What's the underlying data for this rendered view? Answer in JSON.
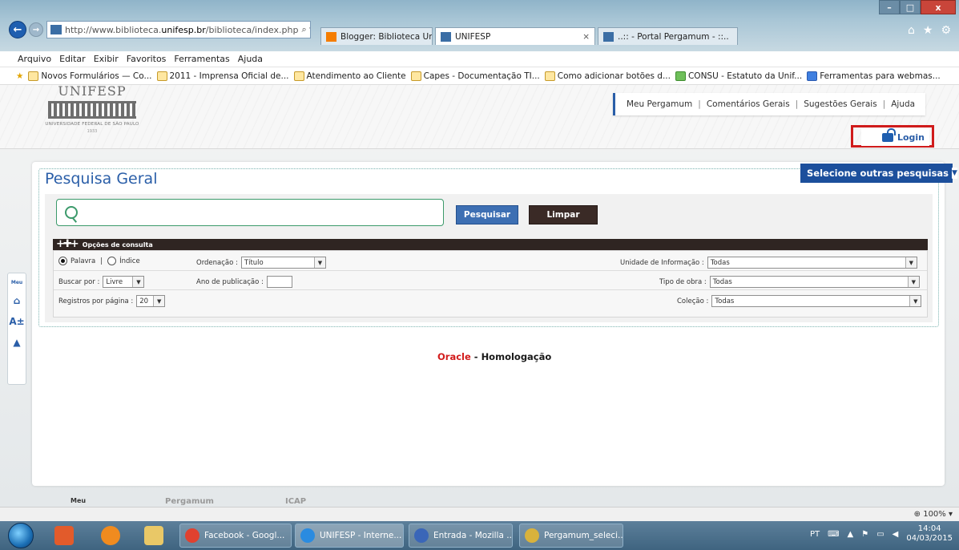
{
  "browser": {
    "url_prefix": "http://www.biblioteca.",
    "url_host": "unifesp.br",
    "url_suffix": "/biblioteca/index.php",
    "url_tools": "⌕ ▾ C",
    "tabs": [
      {
        "label": "Blogger: Biblioteca Unifesp Ca...",
        "icon_color": "#f57d00"
      },
      {
        "label": "UNIFESP",
        "icon_color": "#3b6ea5"
      },
      {
        "label": "..:: - Portal Pergamum - ::..",
        "icon_color": "#3b6ea5"
      }
    ],
    "tab_close": "×",
    "window_controls": {
      "minimize": "–",
      "maximize": "□",
      "close": "x"
    }
  },
  "menubar": [
    "Arquivo",
    "Editar",
    "Exibir",
    "Favoritos",
    "Ferramentas",
    "Ajuda"
  ],
  "favorites": [
    "Novos Formulários — Co...",
    "2011 - Imprensa Oficial de...",
    "Atendimento ao Cliente",
    "Capes - Documentação TI...",
    "Como adicionar botões d...",
    "CONSU - Estatuto da Unif...",
    "Ferramentas para webmas..."
  ],
  "header": {
    "logo_word": "UNIFESP",
    "logo_sub": "UNIVERSIDADE FEDERAL DE SÃO PAULO",
    "logo_year": "1933",
    "links": [
      "Meu Pergamum",
      "Comentários Gerais",
      "Sugestões Gerais",
      "Ajuda"
    ],
    "login_label": "Login"
  },
  "sidetools": {
    "accessibility": "Meu",
    "home": "⌂",
    "font": "A±",
    "top": "▲"
  },
  "search": {
    "title": "Pesquisa Geral",
    "select_other": "Selecione outras pesquisas",
    "search_button": "Pesquisar",
    "clear_button": "Limpar",
    "options_title": "Opções de consulta",
    "radio_word": "Palavra",
    "radio_separator": "|",
    "radio_index": "Índice",
    "order_label": "Ordenação :",
    "order_value": "Título",
    "unit_label": "Unidade de Informação :",
    "unit_value": "Todas",
    "search_by_label": "Buscar por :",
    "search_by_value": "Livre",
    "year_label": "Ano de publicação :",
    "work_type_label": "Tipo de obra :",
    "work_type_value": "Todas",
    "per_page_label": "Registros por página :",
    "per_page_value": "20",
    "collection_label": "Coleção :",
    "collection_value": "Todas"
  },
  "environment": {
    "oracle": "Oracle",
    "separator": " - ",
    "stage": "Homologação"
  },
  "footer_logos": [
    "Meu",
    "Pergamum",
    "ICAP"
  ],
  "statusbar": {
    "zoom": "100%"
  },
  "taskbar": {
    "tasks": [
      {
        "label": "Facebook - Googl...",
        "icon_color": "#e0412f"
      },
      {
        "label": "UNIFESP - Interne...",
        "icon_color": "#2a8be0"
      },
      {
        "label": "Entrada - Mozilla ...",
        "icon_color": "#3a66b8"
      },
      {
        "label": "Pergamum_seleci...",
        "icon_color": "#d8b23c"
      }
    ],
    "language": "PT",
    "time": "14:04",
    "date": "04/03/2015"
  }
}
